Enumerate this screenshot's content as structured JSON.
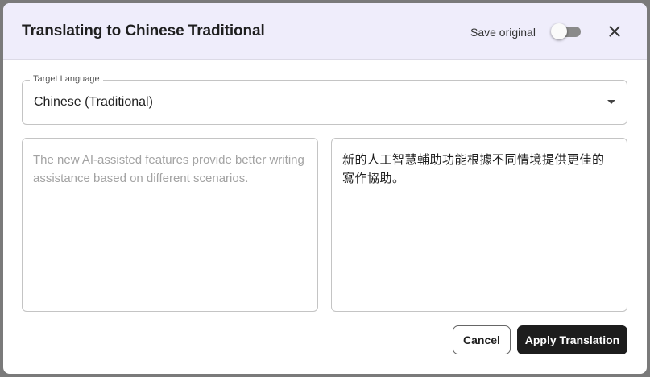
{
  "dialog": {
    "title": "Translating to Chinese Traditional",
    "save_original_label": "Save original",
    "save_original_enabled": false,
    "close_icon": "close-icon"
  },
  "target_language": {
    "label": "Target Language",
    "value": "Chinese (Traditional)",
    "dropdown_icon": "caret-down-icon"
  },
  "source_text": "The new AI-assisted features provide better writing assistance based on different scenarios.",
  "translated_text": "新的人工智慧輔助功能根據不同情境提供更佳的寫作協助。",
  "actions": {
    "cancel_label": "Cancel",
    "apply_label": "Apply Translation"
  }
}
